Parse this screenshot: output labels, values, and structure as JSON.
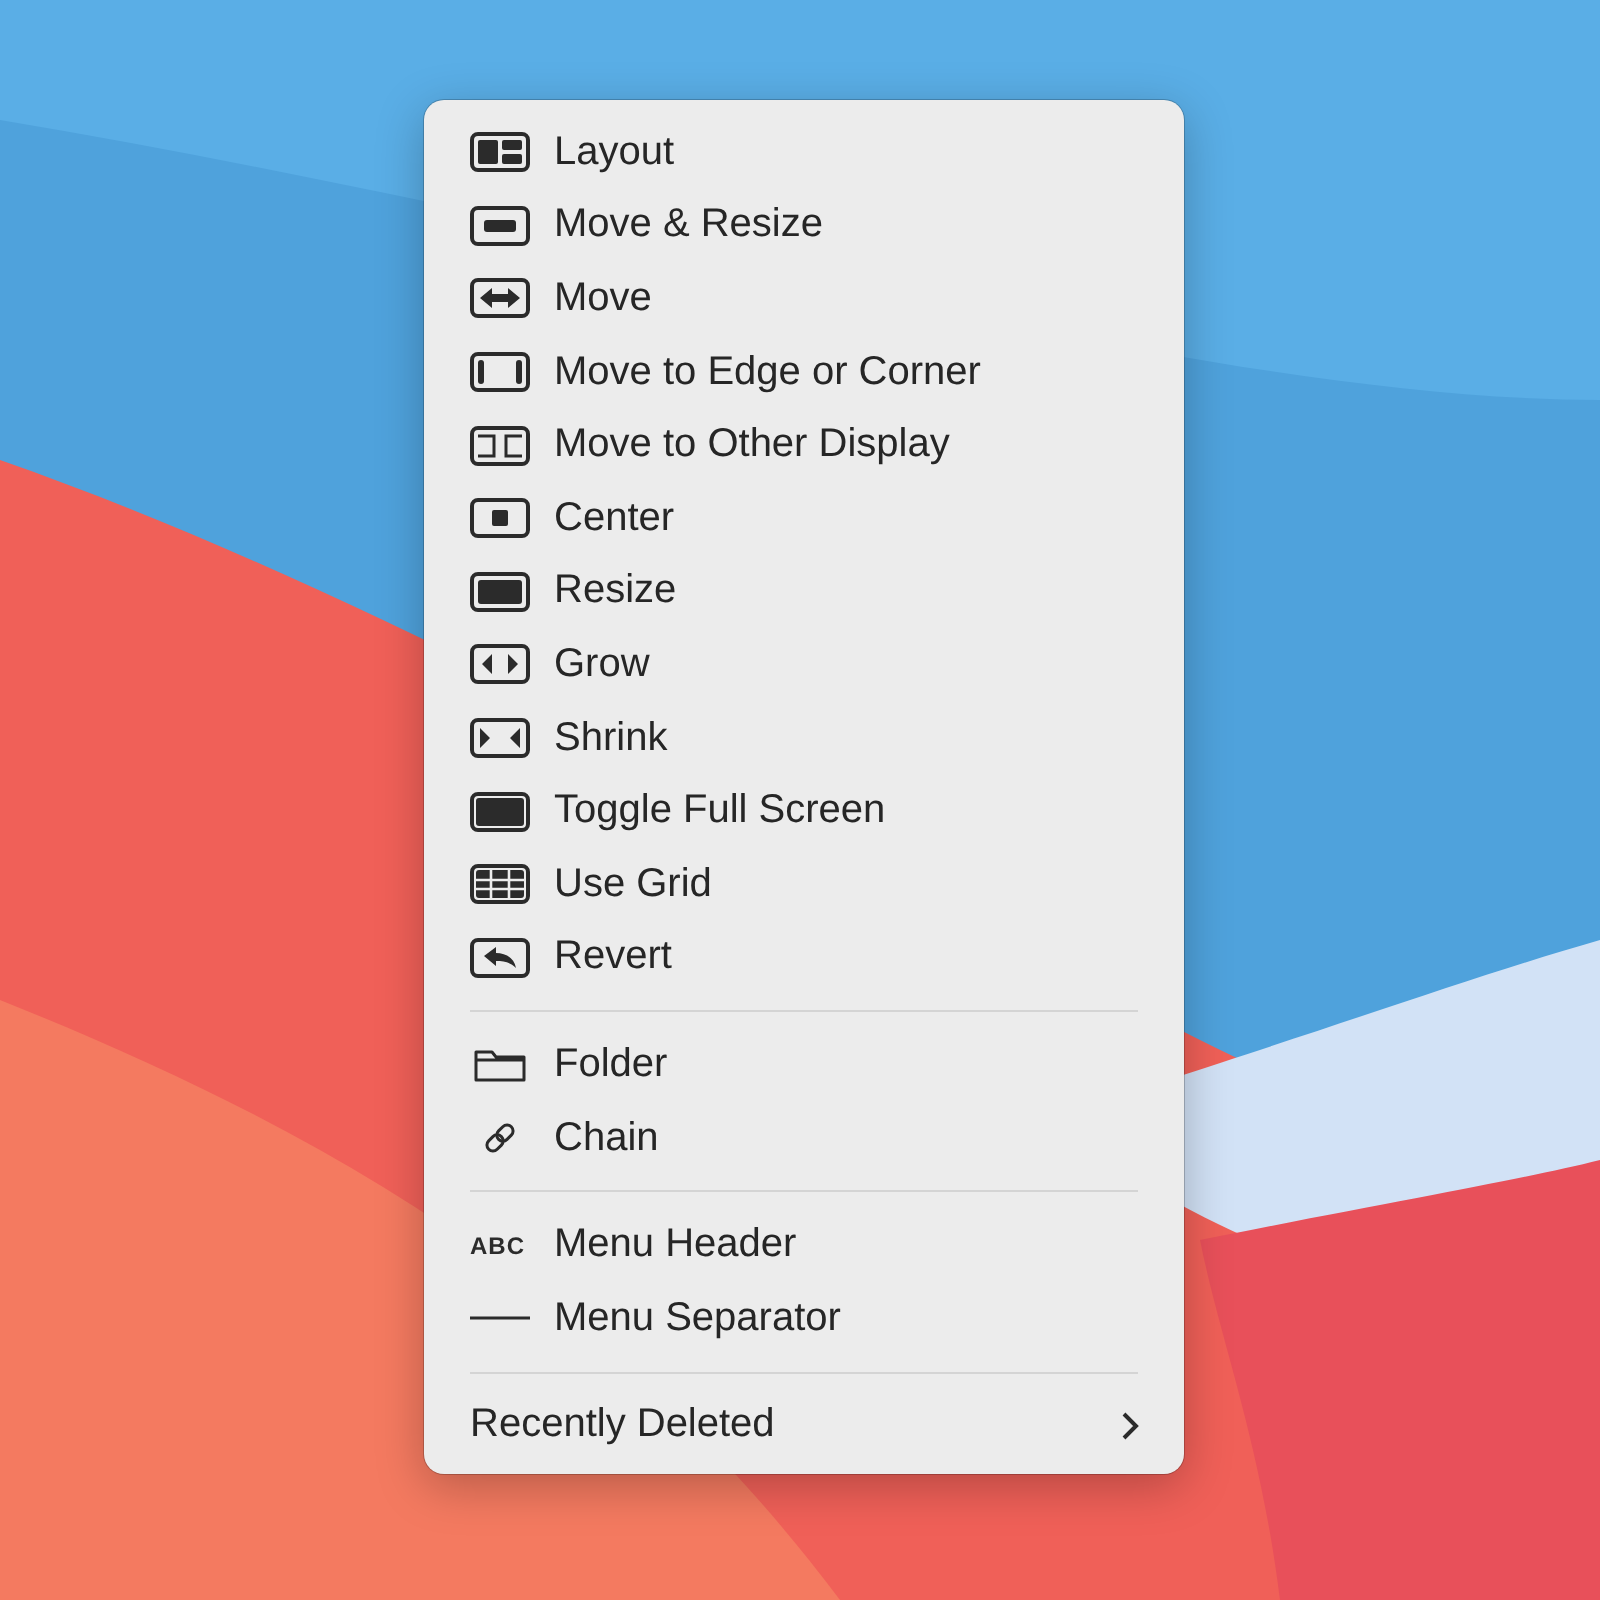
{
  "menu": {
    "sections": [
      {
        "items": [
          {
            "label": "Layout"
          },
          {
            "label": "Move & Resize"
          },
          {
            "label": "Move"
          },
          {
            "label": "Move to Edge or Corner"
          },
          {
            "label": "Move to Other Display"
          },
          {
            "label": "Center"
          },
          {
            "label": "Resize"
          },
          {
            "label": "Grow"
          },
          {
            "label": "Shrink"
          },
          {
            "label": "Toggle Full Screen"
          },
          {
            "label": "Use Grid"
          },
          {
            "label": "Revert"
          }
        ]
      },
      {
        "items": [
          {
            "label": "Folder"
          },
          {
            "label": "Chain"
          }
        ]
      },
      {
        "items": [
          {
            "label": "Menu Header",
            "badge": "ABC"
          },
          {
            "label": "Menu Separator"
          }
        ]
      },
      {
        "items": [
          {
            "label": "Recently Deleted",
            "submenu": true
          }
        ]
      }
    ]
  }
}
